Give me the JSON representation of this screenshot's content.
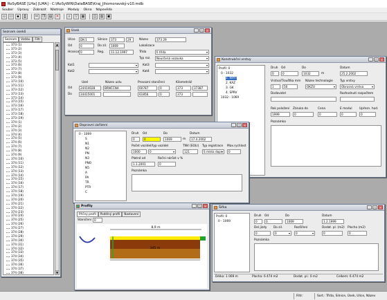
{
  "app": {
    "title": "RoSyBASE [LHa] [LMA] - C:\\RoSyWIN\\DataBASE\\Kraj_Jihomoravský-v10.mdb"
  },
  "menu": [
    "Soubor",
    "Úpravy",
    "Zobrazit",
    "Nástroje",
    "Moduly",
    "Okna",
    "Nápověda"
  ],
  "toolbar_icons": [
    "new-icon",
    "open-icon",
    "save-icon",
    "print-icon",
    "cut-icon",
    "copy-icon",
    "paste-icon",
    "delete-icon",
    "find-icon",
    "filter-icon",
    "grid-icon",
    "map-icon",
    "report-icon",
    "calc-icon"
  ],
  "status": {
    "left": "",
    "filter": "Filtr:",
    "sort": "Sort.: Třída, Silnice, Úsek, Ulice, Název"
  },
  "nav": {
    "title": "Seznam úseků",
    "tabs": [
      "Seznam",
      "Vzdáv.",
      "Filtr"
    ],
    "items": [
      "373 (1)",
      "373 (2)",
      "373 (3)",
      "373 (4)",
      "373 (5)",
      "373 (6)",
      "373 (7)",
      "373 (8)",
      "373 (9)",
      "373 (10)",
      "373 (11)",
      "373 (12)",
      "373 (13)",
      "373 (14)",
      "373 (15)",
      "373 (16)",
      "373 (17)",
      "373 (18)",
      "373 (19)",
      "374 (1)",
      "374 (2)",
      "374 (3)",
      "374 (4)",
      "374 (5)",
      "374 (6)",
      "374 (7)",
      "374 (8)",
      "374 (9)",
      "374 (10)",
      "374 (11)",
      "374 (12)",
      "374 (13)",
      "374 (14)",
      "374 (15)",
      "374 (16)",
      "374 (17)",
      "374 (18)",
      "374 (19)",
      "374 (20)",
      "374 (21)",
      "374 (22)",
      "374 (23)",
      "374 (24)",
      "374 (25)",
      "374 (26)",
      "374 (27)",
      "374 (28)",
      "374 (29)",
      "374 (30)",
      "374 (31)",
      "374 (32)",
      "374 (33)",
      "374 (34)",
      "374 (35)",
      "374 (36)",
      "374 (37)",
      "374 (38)",
      "374 (39)",
      "374 (40)",
      "374 (41)",
      "374 (42)"
    ]
  },
  "masek": {
    "title": "Úsek",
    "labels": {
      "ulice": "Ulice",
      "od": "Od",
      "hranice": "Hranice",
      "kat1": "Kat1",
      "kat2": "Kat2",
      "silnice": "Silnice",
      "do": "Do zil.",
      "reg": "Reg.",
      "nazev": "Název",
      "lokalizace": "Lokalizace",
      "trida": "Třída",
      "typroz": "Typ roz.",
      "kat3": "Kat3",
      "kat4": "Kat4",
      "uzel": "Uzel",
      "nazuzlu": "Název uzlu",
      "provstan": "Provozní staničení",
      "kilom": "Kilometráž",
      "odrow": "Od",
      "dorow": "Do"
    },
    "values": {
      "ulice": "DK-1",
      "od": "0",
      "hranice": "0",
      "silnice": "373",
      "silnice2": "29",
      "do": "1069",
      "reg": "11.12.1997",
      "nazev": "373 29",
      "trida": "II třída",
      "typroz": "Neurčená vozovka",
      "uzel_od": "24414028",
      "nazuzlu_od": "BRNČČNA",
      "prov_od": "60787",
      "prov_od2": "0",
      "km_od": "373",
      "km_od2": "37387",
      "uzel_do": "24415001",
      "prov_do": "61856",
      "prov_do2": "0",
      "km_do": "373",
      "km_do2": ""
    }
  },
  "konstrukce": {
    "title": "Konstrukční vrstvy",
    "tree": [
      "Profil: 0",
      "0 - 1032",
      "1. KRYT",
      "2. KAZ",
      "3. GK",
      "4. SPRV",
      "1032 - 1069"
    ],
    "labels": {
      "druh": "Druh",
      "od": "Od",
      "do": "Do",
      "datum": "Datum",
      "vrstva": "Vrstva/Tloušťka mm",
      "nazev_tech": "Název technologie",
      "typ": "Typ vrstvy",
      "dodavatel": "Dodavatel",
      "rok_pol": "Rok položení",
      "zaruka": "Záruka do",
      "cena": "Cena",
      "rozrovnaci": "Rozhodnutí rozpočtem",
      "emodul": "E modul",
      "ujasn": "Upřesn. hod.",
      "poznamka": "Poznámka",
      "m": "m"
    },
    "values": {
      "druh": "0",
      "od": "0",
      "do": "1032",
      "datum": "25.2.2002",
      "vrstva": "1",
      "tloustka": "50",
      "tech": "OKZU",
      "typ": "Obrusná vrstva",
      "rok": "1999",
      "zaruka": "0",
      "cena": "0",
      "emodul": "0",
      "uprav": "0"
    }
  },
  "dopravni": {
    "title": "Dopravní zařízení",
    "tree": [
      "0 - 1069",
      "S",
      "N1",
      "N2",
      "PN",
      "N3",
      "PNO",
      "N5",
      "A",
      "PA",
      "TR",
      "PTR",
      "C"
    ],
    "labels": {
      "druh": "Druh",
      "od": "Od",
      "do": "Do",
      "datum": "Datum",
      "pocet": "Počet vozidel/typ vozidel",
      "tnv": "TNV (EOLI)",
      "typ_reg": "Typ registrace",
      "max_rych": "Max.rychlost",
      "platne": "Platné od",
      "rocni": "Roční nárůst v %",
      "poznamka": "Poznámka",
      "m": "m"
    },
    "values": {
      "druh": "0",
      "od": "0",
      "do": "1069",
      "datum": "17.4.2002",
      "pocet": "1000",
      "typv": "0",
      "tnv": "121",
      "typ_reg": "S místa dopr",
      "max": "0",
      "platne": "1.1.2001",
      "rocni": "0"
    }
  },
  "profily": {
    "title": "Profily",
    "tabs": [
      "Příčný profil",
      "Podélný profil",
      "Nastavení"
    ],
    "stanice_label": "Staničení",
    "stanice": "0",
    "width_top": "8,9 m",
    "width_mid": "345 m"
  },
  "sirka": {
    "title": "Šířka",
    "tree": [
      "Profil: 0",
      "0 - 1069"
    ],
    "labels": {
      "druh": "Druh",
      "od": "Od",
      "do": "Do",
      "datum": "Datum",
      "del_jizdy": "Del.jízdy",
      "do2": "Do zil.",
      "rozsirenvo": "Rozšíření",
      "dodat": "Dodat. pl. (m2)",
      "plocha": "Plocha (m2)",
      "poznamka": "Poznámka"
    },
    "values": {
      "druh": "0",
      "od": "0",
      "do": "1069",
      "datum": "1.2.1999",
      "dj": "0",
      "sk": "0",
      "rz": "0",
      "dp": "0",
      "pl": "0"
    },
    "footer": {
      "delka": "Délka: 1 069 m",
      "plocha": "Plocha: 6 474 m2",
      "dodat": "Dodat. pl.: 0 m2",
      "celkem": "Celkem: 6 474 m2"
    }
  }
}
